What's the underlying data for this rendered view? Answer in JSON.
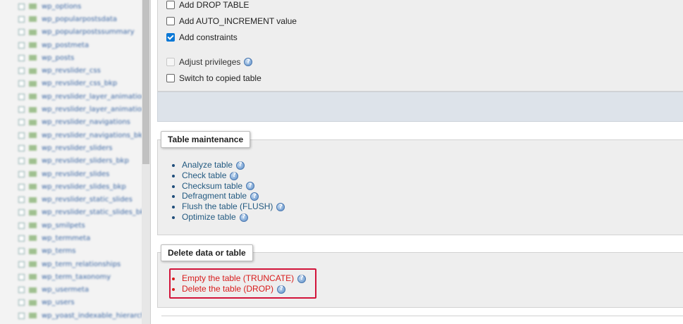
{
  "sidebar": {
    "items": [
      "wp_options",
      "wp_popularpostsdata",
      "wp_popularpostssummary",
      "wp_postmeta",
      "wp_posts",
      "wp_revslider_css",
      "wp_revslider_css_bkp",
      "wp_revslider_layer_animations",
      "wp_revslider_layer_animations_bkp",
      "wp_revslider_navigations",
      "wp_revslider_navigations_bkp",
      "wp_revslider_sliders",
      "wp_revslider_sliders_bkp",
      "wp_revslider_slides",
      "wp_revslider_slides_bkp",
      "wp_revslider_static_slides",
      "wp_revslider_static_slides_bkp",
      "wp_smilpets",
      "wp_termmeta",
      "wp_terms",
      "wp_term_relationships",
      "wp_term_taxonomy",
      "wp_usermeta",
      "wp_users",
      "wp_yoast_indexable_hierarchy"
    ]
  },
  "copy_options": {
    "add_drop_table": {
      "label": "Add DROP TABLE",
      "checked": false
    },
    "add_auto_increment": {
      "label": "Add AUTO_INCREMENT value",
      "checked": false
    },
    "add_constraints": {
      "label": "Add constraints",
      "checked": true
    },
    "adjust_privileges": {
      "label": "Adjust privileges",
      "checked": false,
      "disabled": true
    },
    "switch_to_copied": {
      "label": "Switch to copied table",
      "checked": false
    }
  },
  "maintenance": {
    "legend": "Table maintenance",
    "actions": [
      "Analyze table",
      "Check table",
      "Checksum table",
      "Defragment table",
      "Flush the table (FLUSH)",
      "Optimize table"
    ]
  },
  "delete_data": {
    "legend": "Delete data or table",
    "actions": [
      "Empty the table (TRUNCATE)",
      "Delete the table (DROP)"
    ]
  },
  "colors": {
    "link": "#235a81",
    "danger": "#d81b1b",
    "highlight_border": "#d2143a",
    "checkbox_checked": "#0a78d6"
  },
  "icons": {
    "help": "question-circle-icon",
    "table": "table-icon",
    "expand": "expand-toggle-icon"
  }
}
